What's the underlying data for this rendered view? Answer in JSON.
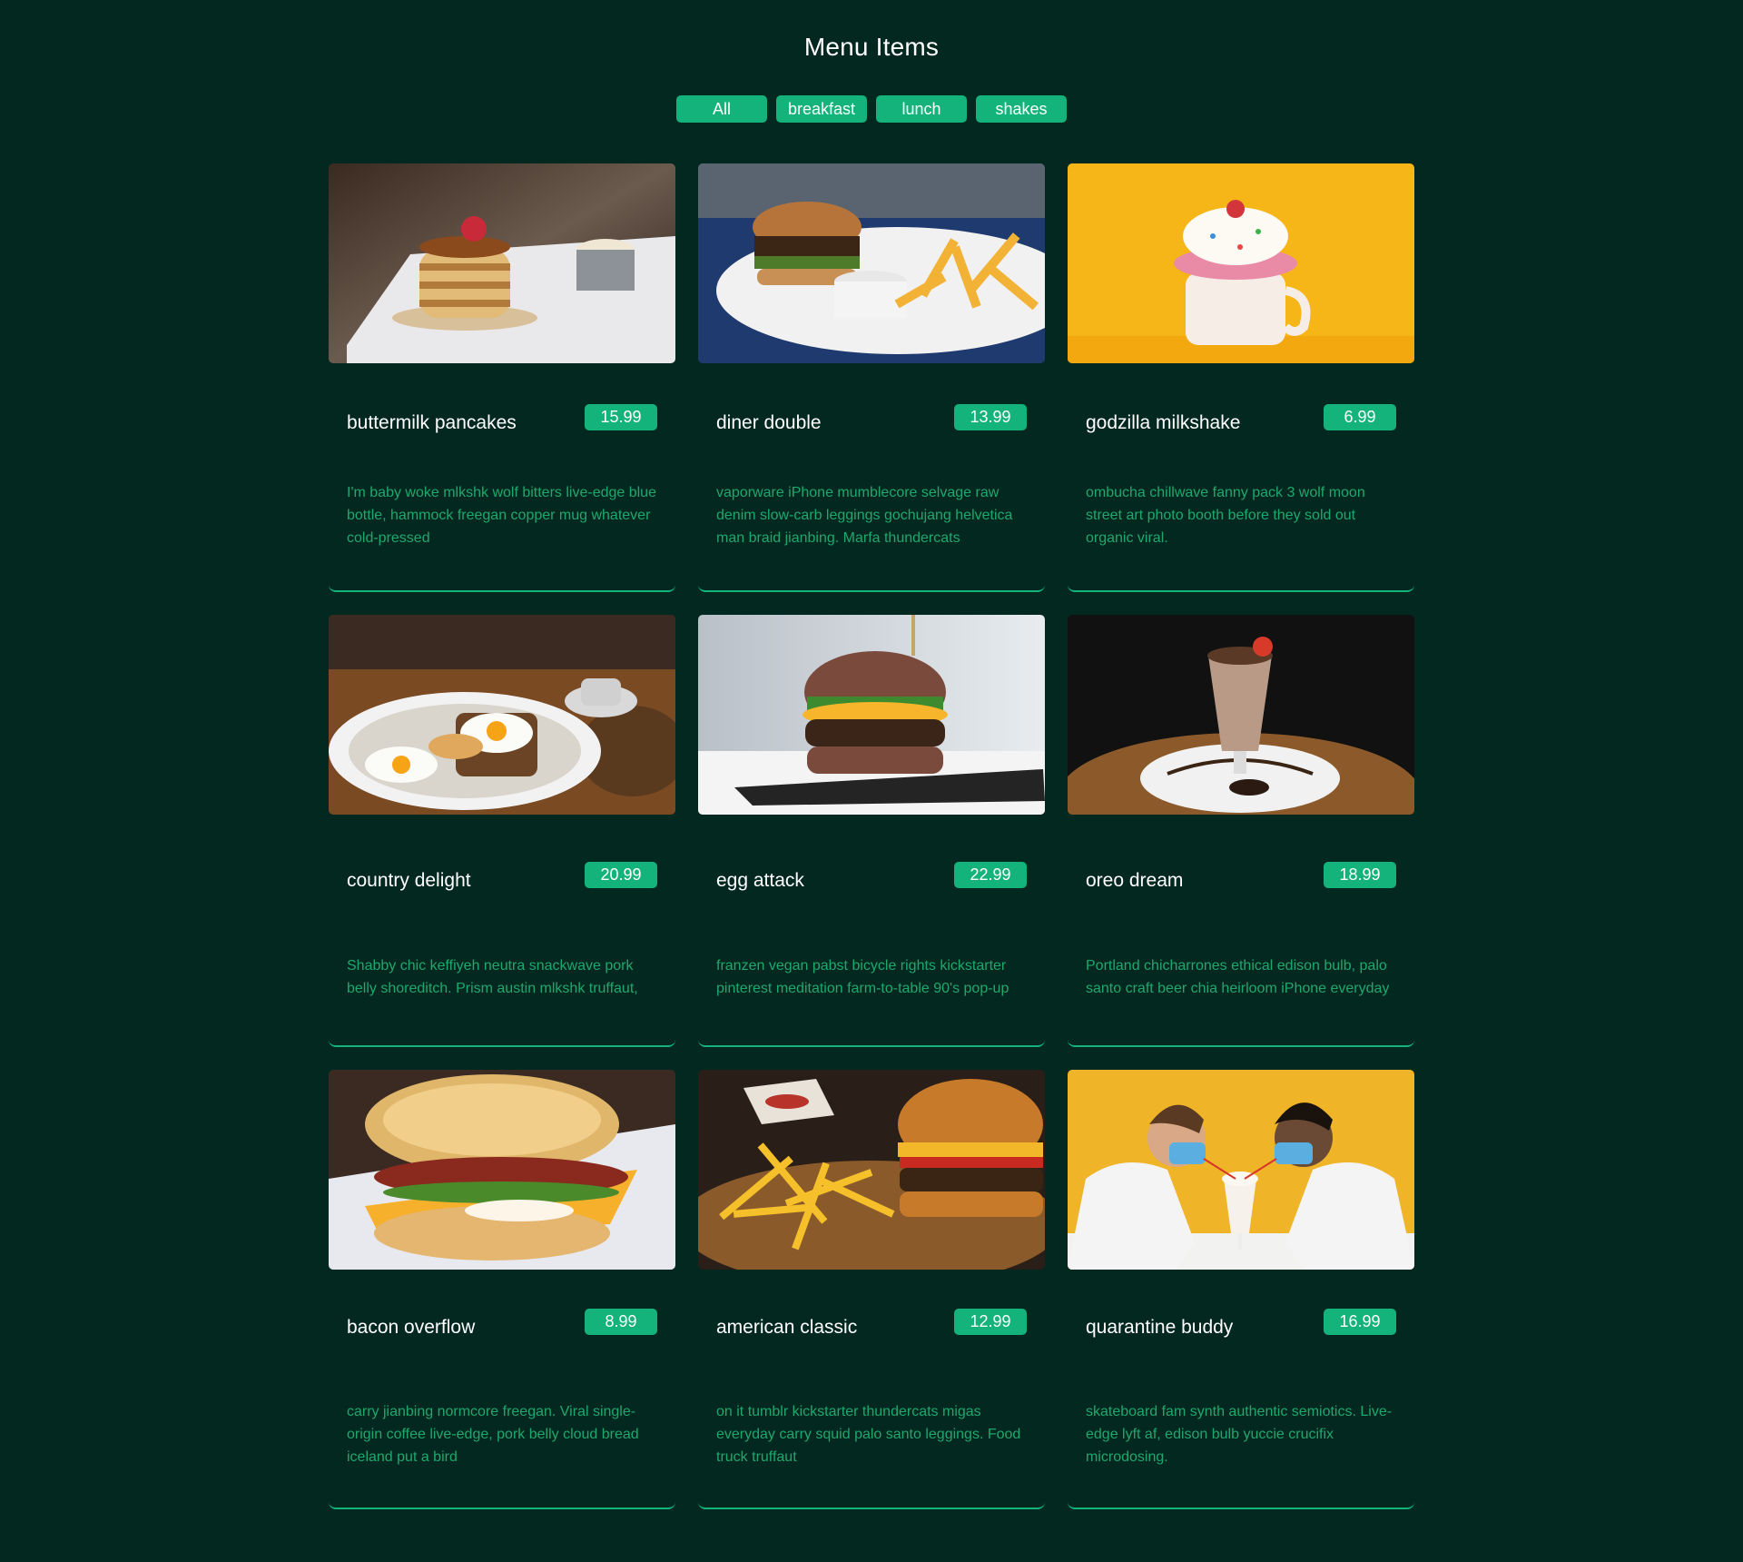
{
  "page": {
    "title": "Menu Items"
  },
  "filters": [
    {
      "label": "All"
    },
    {
      "label": "breakfast"
    },
    {
      "label": "lunch"
    },
    {
      "label": "shakes"
    }
  ],
  "colors": {
    "background": "#032820",
    "accent": "#13b37b",
    "description_text": "#1fa86e",
    "title_text": "#ffffff"
  },
  "items": [
    {
      "name": "buttermilk pancakes",
      "price": "15.99",
      "desc": "I'm baby woke mlkshk wolf bitters live-edge blue bottle, hammock freegan copper mug whatever cold-pressed",
      "image": "pancakes-photo"
    },
    {
      "name": "diner double",
      "price": "13.99",
      "desc": "vaporware iPhone mumblecore selvage raw denim slow-carb leggings gochujang helvetica man braid jianbing. Marfa thundercats",
      "image": "burger-fries-photo"
    },
    {
      "name": "godzilla milkshake",
      "price": "6.99",
      "desc": "ombucha chillwave fanny pack 3 wolf moon street art photo booth before they sold out organic viral.",
      "image": "milkshake-yellow-photo"
    },
    {
      "name": "country delight",
      "price": "20.99",
      "desc": "Shabby chic keffiyeh neutra snackwave pork belly shoreditch. Prism austin mlkshk truffaut,",
      "image": "eggs-toast-photo"
    },
    {
      "name": "egg attack",
      "price": "22.99",
      "desc": "franzen vegan pabst bicycle rights kickstarter pinterest meditation farm-to-table 90's pop-up",
      "image": "egg-burger-photo"
    },
    {
      "name": "oreo dream",
      "price": "18.99",
      "desc": "Portland chicharrones ethical edison bulb, palo santo craft beer chia heirloom iPhone everyday",
      "image": "oreo-shake-photo"
    },
    {
      "name": "bacon overflow",
      "price": "8.99",
      "desc": "carry jianbing normcore freegan. Viral single-origin coffee live-edge, pork belly cloud bread iceland put a bird",
      "image": "bacon-biscuit-photo"
    },
    {
      "name": "american classic",
      "price": "12.99",
      "desc": "on it tumblr kickstarter thundercats migas everyday carry squid palo santo leggings. Food truck truffaut",
      "image": "cheeseburger-fries-photo"
    },
    {
      "name": "quarantine buddy",
      "price": "16.99",
      "desc": "skateboard fam synth authentic semiotics. Live-edge lyft af, edison bulb yuccie crucifix microdosing.",
      "image": "couple-milkshake-photo"
    }
  ]
}
